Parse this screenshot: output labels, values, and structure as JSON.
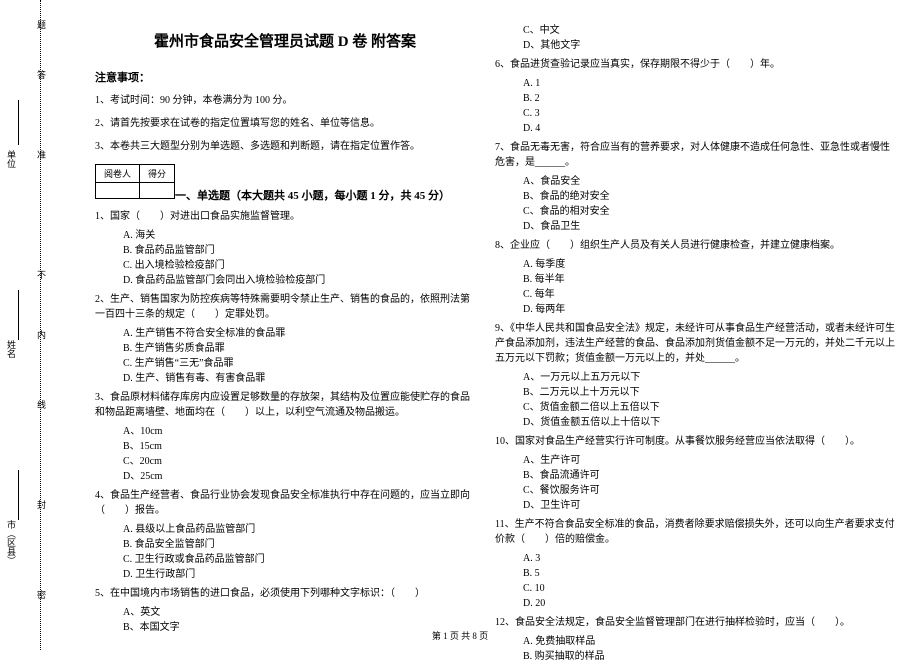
{
  "binding": {
    "city_label": "市（区县）",
    "name_label": "姓名",
    "unit_label": "单位",
    "seal": "密",
    "cut": "封",
    "line": "线",
    "inner": "内",
    "no": "不",
    "zhun": "准",
    "ge": "答",
    "kao": "题"
  },
  "title": "霍州市食品安全管理员试题 D 卷 附答案",
  "notice": {
    "heading": "注意事项：",
    "item1": "1、考试时间：90 分钟，本卷满分为 100 分。",
    "item2": "2、请首先按要求在试卷的指定位置填写您的姓名、单位等信息。",
    "item3": "3、本卷共三大题型分别为单选题、多选题和判断题，请在指定位置作答。"
  },
  "score_table": {
    "h1": "阅卷人",
    "h2": "得分"
  },
  "section1_title": "一、单选题（本大题共 45 小题，每小题 1 分，共 45 分）",
  "q1": {
    "text": "1、国家（　　）对进出口食品实施监督管理。",
    "a": "A. 海关",
    "b": "B. 食品药品监管部门",
    "c": "C. 出入境检验检疫部门",
    "d": "D. 食品药品监管部门会同出入境检验检疫部门"
  },
  "q2": {
    "text": "2、生产、销售国家为防控疾病等特殊需要明令禁止生产、销售的食品的，依照刑法第一百四十三条的规定（　　）定罪处罚。",
    "a": "A. 生产销售不符合安全标准的食品罪",
    "b": "B. 生产销售劣质食品罪",
    "c": "C. 生产销售“三无”食品罪",
    "d": "D. 生产、销售有毒、有害食品罪"
  },
  "q3": {
    "text": "3、食品原材料储存库房内应设置足够数量的存放架，其结构及位置应能使贮存的食品和物品距离墙壁、地面均在（　　）以上，以利空气流通及物品搬运。",
    "a": "A、10cm",
    "b": "B、15cm",
    "c": "C、20cm",
    "d": "D、25cm"
  },
  "q4": {
    "text": "4、食品生产经营者、食品行业协会发现食品安全标准执行中存在问题的，应当立即向（　　）报告。",
    "a": "A. 县级以上食品药品监管部门",
    "b": "B. 食品安全监管部门",
    "c": "C. 卫生行政或食品药品监管部门",
    "d": "D. 卫生行政部门"
  },
  "q5": {
    "text": "5、在中国境内市场销售的进口食品，必须使用下列哪种文字标识：（　　）",
    "a": "A、英文",
    "b": "B、本国文字"
  },
  "q5r": {
    "c": "C、中文",
    "d": "D、其他文字"
  },
  "q6": {
    "text": "6、食品进货查验记录应当真实，保存期限不得少于（　　）年。",
    "a": "A. 1",
    "b": "B. 2",
    "c": "C. 3",
    "d": "D. 4"
  },
  "q7": {
    "text": "7、食品无毒无害，符合应当有的营养要求，对人体健康不造成任何急性、亚急性或者慢性危害，是______。",
    "a": "A、食品安全",
    "b": "B、食品的绝对安全",
    "c": "C、食品的相对安全",
    "d": "D、食品卫生"
  },
  "q8": {
    "text": "8、企业应（　　）组织生产人员及有关人员进行健康检查，并建立健康档案。",
    "a": "A. 每季度",
    "b": "B. 每半年",
    "c": "C. 每年",
    "d": "D. 每两年"
  },
  "q9": {
    "text": "9、《中华人民共和国食品安全法》规定，未经许可从事食品生产经营活动，或者未经许可生产食品添加剂，违法生产经营的食品、食品添加剂货值金额不足一万元的，并处二千元以上五万元以下罚款；货值金额一万元以上的，并处______。",
    "a": "A、一万元以上五万元以下",
    "b": "B、二万元以上十万元以下",
    "c": "C、货值金额二倍以上五倍以下",
    "d": "D、货值金额五倍以上十倍以下"
  },
  "q10": {
    "text": "10、国家对食品生产经营实行许可制度。从事餐饮服务经营应当依法取得（　　）。",
    "a": "A、生产许可",
    "b": "B、食品流通许可",
    "c": "C、餐饮服务许可",
    "d": "D、卫生许可"
  },
  "q11": {
    "text": "11、生产不符合食品安全标准的食品，消费者除要求赔偿损失外，还可以向生产者要求支付价款（　　）倍的赔偿金。",
    "a": "A. 3",
    "b": "B. 5",
    "c": "C. 10",
    "d": "D. 20"
  },
  "q12": {
    "text": "12、食品安全法规定，食品安全监督管理部门在进行抽样检验时，应当（　　）。",
    "a": "A. 免费抽取样品",
    "b": "B. 购买抽取的样品"
  },
  "footer": "第 1 页 共 8 页"
}
